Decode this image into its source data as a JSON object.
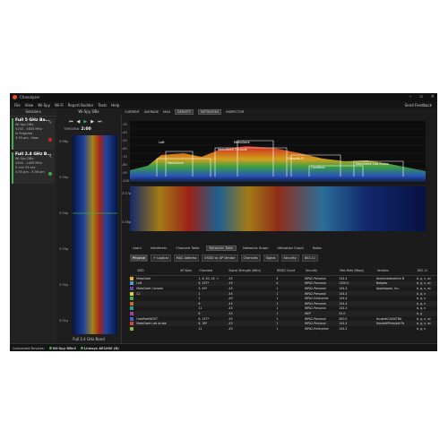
{
  "window": {
    "title": "Chanalyzer",
    "min": "–",
    "max": "▫",
    "close": "×"
  },
  "menu": [
    "File",
    "View",
    "Wi-Spy",
    "Wi-Fi",
    "Report Builder",
    "Tools",
    "Help"
  ],
  "feedback": "Send Feedback",
  "sessions": {
    "header": "Sessions",
    "items": [
      {
        "name": "Full 5 GHz Ba...",
        "device": "Wi-Spy DBx",
        "range": "5150 - 5835 MHz",
        "status": "In Progress",
        "time": "3:30 pm - Now",
        "color": "#e0202a"
      },
      {
        "name": "Full 2.4 GHz B...",
        "device": "Wi-Spy DBx",
        "range": "2400 - 2495 MHz",
        "status": "5 min 59 sec",
        "time": "3:30 pm - 3:36 pm",
        "color": "#3fae49"
      }
    ]
  },
  "wifispy": {
    "header": "Wi-Spy DBx",
    "controls": [
      "⏮",
      "◀",
      "▶",
      "▶",
      "⏭"
    ],
    "timespan_label": "TIMESPAN",
    "timespan": "2:00",
    "band": "Full 2.4 GHz Band",
    "times": [
      "3:36p",
      "3:35p",
      "3:34p",
      "3:33p",
      "3:32p",
      "3:31p"
    ]
  },
  "toolbar": [
    "CURRENT",
    "AVERAGE",
    "MAX",
    "DENSITY",
    "NETWORKS",
    "INSPECTOR"
  ],
  "spectrum": {
    "y_ticks": [
      "-30",
      "-40",
      "-50",
      "-60",
      "-70",
      "-80",
      "-90",
      "-100"
    ],
    "x_ticks": [
      "1",
      "2",
      "3",
      "4",
      "5",
      "6",
      "7",
      "8",
      "9",
      "10",
      "11",
      "12",
      "13",
      "14"
    ],
    "networks": [
      "MetaGeek",
      "MetaGeek Console",
      "Loft",
      "MetaGeek",
      "CrossWi-Fi",
      "OaxiReel",
      "MetaGeek Lab Arubo"
    ],
    "wf_times": [
      "3:37p",
      "3:36p"
    ]
  },
  "tabs": [
    "Learn",
    "Interferers",
    "Channels Table",
    "Networks Table",
    "Networks Graph",
    "Utilization Graph",
    "Notes"
  ],
  "filters": [
    "Physical",
    "+ Logical",
    "MAC Address",
    "ESSID or AP Vendor",
    "Channels",
    "Signal",
    "Security",
    "802.11"
  ],
  "table": {
    "headers": [
      "",
      "SSID",
      "AP Alias",
      "Channels",
      "Signal Strength (dBm)",
      "BSSID Count",
      "Security",
      "Max Rate (Mbps)",
      "Vendors",
      "802.11"
    ],
    "rows": [
      {
        "ssid": "MetaGeek",
        "alias": "",
        "ch": "1, 6, 40, 44, +",
        "sig": "-45",
        "cnt": "4",
        "sec": "WPA2-Personal",
        "rate": "144.4",
        "vendor": "AerohiveAerohive N",
        "std": "b, g, n, ac",
        "color": "#e8b020"
      },
      {
        "ssid": "Loft",
        "alias": "",
        "ch": "9, 157*",
        "sig": "-45",
        "cnt": "4",
        "sec": "WPA2-Personal",
        "rate": "1300.0",
        "vendor": "Netgear",
        "std": "b, g, n, ac",
        "color": "#3f9fd8"
      },
      {
        "ssid": "MetaGeek Console",
        "alias": "",
        "ch": "3, 40*",
        "sig": "-45",
        "cnt": "1",
        "sec": "WPA2-Personal",
        "rate": "144.4",
        "vendor": "AppleApple, Inc.",
        "std": "b, g, n, ac",
        "color": "#6a3fa8"
      },
      {
        "ssid": "C1",
        "alias": "",
        "ch": "1",
        "sig": "-45",
        "cnt": "1",
        "sec": "WPA2-Personal",
        "rate": "144.4",
        "vendor": "",
        "std": "b, g, n",
        "color": "#d8d820"
      },
      {
        "ssid": "",
        "alias": "",
        "ch": "1",
        "sig": "-45",
        "cnt": "1",
        "sec": "WPA2-Enterprise",
        "rate": "144.4",
        "vendor": "",
        "std": "b, g, n",
        "color": "#3fae49"
      },
      {
        "ssid": "",
        "alias": "",
        "ch": "6",
        "sig": "-45",
        "cnt": "1",
        "sec": "WPA2-Personal",
        "rate": "144.4",
        "vendor": "",
        "std": "b, g, n",
        "color": "#e06020"
      },
      {
        "ssid": "",
        "alias": "",
        "ch": "11",
        "sig": "-45",
        "cnt": "1",
        "sec": "WPA2-Personal",
        "rate": "144.4",
        "vendor": "",
        "std": "b, g, n",
        "color": "#20a0a0"
      },
      {
        "ssid": "",
        "alias": "",
        "ch": "6",
        "sig": "-45",
        "cnt": "1",
        "sec": "WEP",
        "rate": "54.0",
        "vendor": "",
        "std": "b, g",
        "color": "#a03fa8"
      },
      {
        "ssid": "OaxiReelWGST",
        "alias": "",
        "ch": "6, 157*",
        "sig": "-45",
        "cnt": "1",
        "sec": "WPA2-Personal",
        "rate": "400.0",
        "vendor": "AsustekCASUSTek",
        "std": "b, g, n, ac",
        "color": "#3f60d8"
      },
      {
        "ssid": "MetaGeek Lab Aruba",
        "alias": "",
        "ch": "6, 36*",
        "sig": "-45",
        "cnt": "1",
        "sec": "WPA2-Personal",
        "rate": "144.4",
        "vendor": "HewlettPHewlett Pa",
        "std": "b, g, n, ac",
        "color": "#d83f3f"
      },
      {
        "ssid": "",
        "alias": "",
        "ch": "11",
        "sig": "-45",
        "cnt": "1",
        "sec": "WPA2-Enterprise",
        "rate": "144.4",
        "vendor": "",
        "std": "b, g, n",
        "color": "#8fae3f"
      }
    ]
  },
  "status": {
    "label": "Connected Devices:",
    "dev1": "Wi-Spy DBx3",
    "dev2": "Linksys AE1000 (B)"
  }
}
